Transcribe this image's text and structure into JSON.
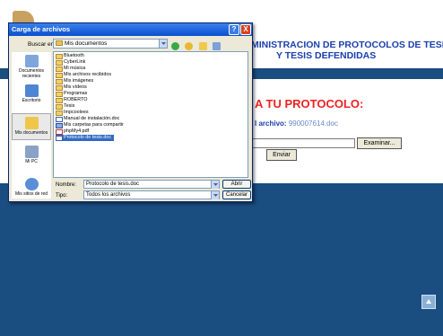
{
  "page": {
    "title_line1": "MINISTRACION DE PROTOCOLOS DE TESIS",
    "title_line2": "Y TESIS DEFENDIDAS",
    "heading": "A TU PROTOCOLO:",
    "file_label": "l archivo:",
    "file_value": "990007614.doc",
    "browse_label": "Examinar...",
    "send_label": "Enviar"
  },
  "dialog": {
    "title": "Carga de archivos",
    "help_label": "?",
    "close_label": "X",
    "look_in_label": "Buscar en:",
    "look_in_value": "Mis documentos",
    "places": [
      {
        "label": "Documentos recientes",
        "icon": "recent-documents-icon"
      },
      {
        "label": "Escritorio",
        "icon": "desktop-icon"
      },
      {
        "label": "Mis documentos",
        "icon": "my-documents-icon"
      },
      {
        "label": "Mi PC",
        "icon": "my-computer-icon"
      },
      {
        "label": "Mis sitios de red",
        "icon": "network-places-icon"
      }
    ],
    "files": [
      {
        "name": "Bluetooth",
        "kind": "folder"
      },
      {
        "name": "CyberLink",
        "kind": "folder"
      },
      {
        "name": "Mi música",
        "kind": "folder"
      },
      {
        "name": "Mis archivos recibidos",
        "kind": "folder"
      },
      {
        "name": "Mis imágenes",
        "kind": "folder"
      },
      {
        "name": "Mis vídeos",
        "kind": "folder"
      },
      {
        "name": "Programas",
        "kind": "folder"
      },
      {
        "name": "ROBERTO",
        "kind": "folder"
      },
      {
        "name": "Tesis",
        "kind": "folder"
      },
      {
        "name": "Impcoolees",
        "kind": "folder"
      },
      {
        "name": "Manual de instalación.doc",
        "kind": "doc"
      },
      {
        "name": "Mis carpetas para compartir",
        "kind": "sys"
      },
      {
        "name": "phpMy4.pdf",
        "kind": "pdf"
      },
      {
        "name": "Protocolo de tesis.doc",
        "kind": "doc",
        "selected": true
      }
    ],
    "filename_label": "Nombre:",
    "filename_value": "Protocolo de tesis.doc",
    "filetype_label": "Tipo:",
    "filetype_value": "Todos los archivos",
    "open_label": "Abrir",
    "cancel_label": "Cancelar"
  },
  "colors": {
    "page_bg": "#1a4d80",
    "title_blue": "#1a3fae",
    "heading_red": "#ee2222",
    "titlebar_blue": "#0a4fd0",
    "selection_blue": "#316ac5"
  }
}
